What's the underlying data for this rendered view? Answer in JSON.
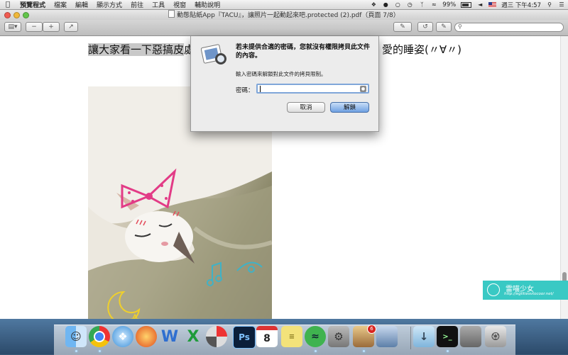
{
  "menubar": {
    "apple": "",
    "app": "預覽程式",
    "items": [
      "檔案",
      "編輯",
      "顯示方式",
      "前往",
      "工具",
      "視窗",
      "輔助說明"
    ],
    "battery": "99%",
    "clock": "週三 下午4:57"
  },
  "window": {
    "title": "動態貼紙App『TACU』，讓照片一起動起來吧.protected (2).pdf（頁面 7/8）"
  },
  "toolbar": {
    "search_placeholder": ""
  },
  "document": {
    "text_left_highlighted": "讓大家看一下惡搞皮",
    "text_left": "處",
    "text_right": "愛的睡姿(〃∀〃)"
  },
  "dialog": {
    "title": "若未提供合適的密碼，您就沒有權限拷貝此文件的內容。",
    "message": "輸入密碼來解鎖對此文件的拷貝限制。",
    "password_label": "密碼：",
    "password_value": "",
    "cancel_label": "取消",
    "unlock_label": "解鎖"
  },
  "dock": {
    "items": [
      "finder-icon",
      "chrome-icon",
      "safari-icon",
      "app-icon",
      "word-icon",
      "excel-icon",
      "disk-utility-icon",
      "photoshop-icon",
      "calendar-icon",
      "stickies-icon",
      "spotify-icon",
      "system-preferences-icon",
      "preview-icon",
      "photo-browser-icon",
      "downloads-icon",
      "terminal-icon",
      "display-icon",
      "trash-icon"
    ],
    "calendar_day": "8",
    "badge": "6"
  },
  "watermark": {
    "title": "雷喵少女",
    "url": "http://eglitiesvtocoor.net/"
  },
  "colors": {
    "accent": "#6fa1e2",
    "watermark": "#39c9c4"
  }
}
